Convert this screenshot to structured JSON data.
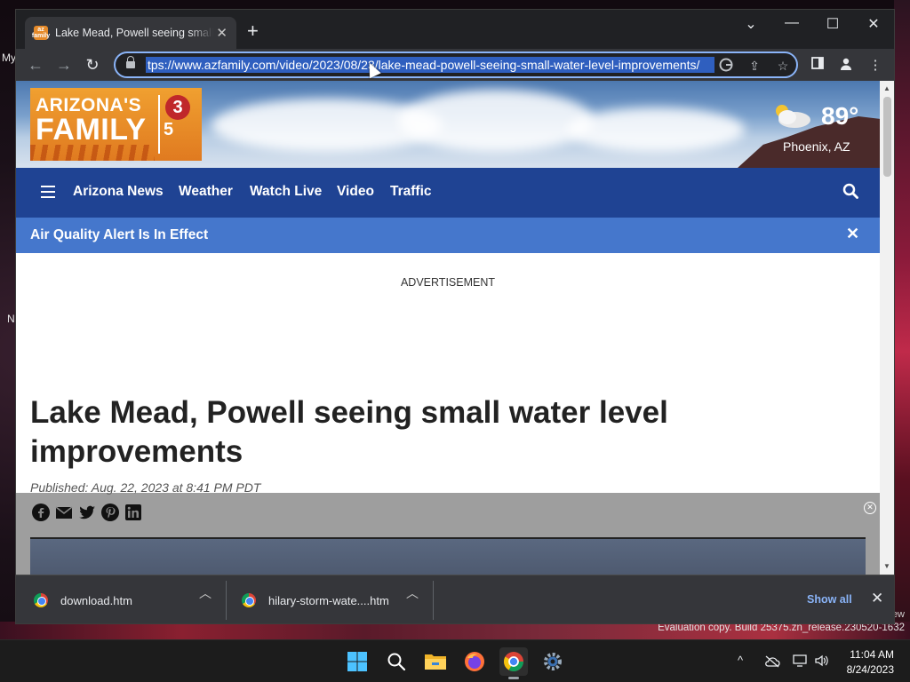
{
  "desktop": {
    "frag_my": "My",
    "frag_n": "N",
    "eval_top": "ew",
    "evaluation": "Evaluation copy. Build 25375.zn_release.230520-1632"
  },
  "browser": {
    "tab": {
      "favicon_text": "az family",
      "title": "Lake Mead, Powell seeing small water level improvements"
    },
    "new_tab": "+",
    "window_controls": {
      "chevron": "⌄",
      "minimize": "—",
      "maximize": "☐",
      "close": "✕"
    },
    "url": "tps://www.azfamily.com/video/2023/08/23/lake-mead-powell-seeing-small-water-level-improvements/",
    "nav": {
      "back": "←",
      "forward": "→",
      "reload": "↻"
    }
  },
  "page": {
    "logo": {
      "line1": "ARIZONA'S",
      "line2": "FAMILY",
      "num3": "3",
      "num5": "5"
    },
    "weather": {
      "temp": "89°",
      "city": "Phoenix, AZ"
    },
    "nav_items": [
      "Arizona News",
      "Weather",
      "Watch Live",
      "Video",
      "Traffic"
    ],
    "alert": {
      "text": "Air Quality Alert Is In Effect",
      "close": "✕"
    },
    "advertisement": "ADVERTISEMENT",
    "headline": "Lake Mead, Powell seeing small water level improvements",
    "published": "Published: Aug. 22, 2023 at 8:41 PM PDT"
  },
  "downloads": {
    "items": [
      {
        "name": "download.htm"
      },
      {
        "name": "hilary-storm-wate....htm"
      }
    ],
    "show_all": "Show all",
    "close": "✕"
  },
  "taskbar": {
    "time": "11:04 AM",
    "date": "8/24/2023",
    "tray_chevron": "^"
  },
  "colors": {
    "nav_blue": "#1f4393",
    "alert_blue": "#4577cc",
    "logo_orange": "#e8902a",
    "chrome_dark": "#202124",
    "url_highlight": "#2f5fbf"
  }
}
